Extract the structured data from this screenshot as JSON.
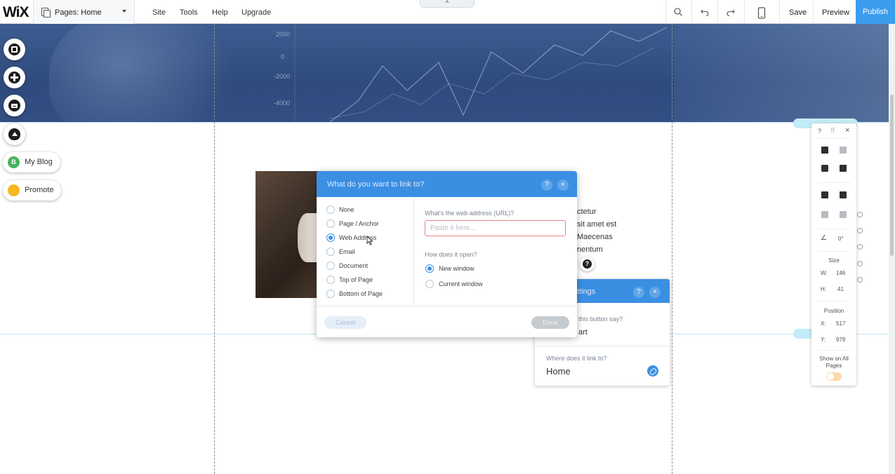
{
  "topbar": {
    "logo": "WiX",
    "pages_label": "Pages: Home",
    "menu": [
      "Site",
      "Tools",
      "Help",
      "Upgrade"
    ],
    "top_tab_glyph": "^",
    "icons": [
      "zoom-icon",
      "undo-icon",
      "redo-icon",
      "mobile-icon"
    ],
    "save": "Save",
    "preview": "Preview",
    "publish": "Publish"
  },
  "hero": {
    "axis_labels": [
      "2000",
      "0",
      "-2000",
      "-4000"
    ]
  },
  "left_tools": {
    "blog_badge": "B",
    "my_blog": "My Blog",
    "promote": "Promote"
  },
  "content": {
    "text_lines": [
      "ctetur",
      "sit amet est",
      "Maecenas",
      "nentum"
    ]
  },
  "link_dialog": {
    "title": "What do you want to link to?",
    "help": "?",
    "close": "×",
    "options": [
      "None",
      "Page / Anchor",
      "Web Address",
      "Email",
      "Document",
      "Top of Page",
      "Bottom of Page"
    ],
    "selected_option": "Web Address",
    "url_label": "What's the web address (URL)?",
    "url_placeholder": "Paste it here...",
    "url_value": "",
    "open_label": "How does it open?",
    "open_options": [
      "New window",
      "Current window"
    ],
    "open_selected": "New window",
    "cancel": "Cancel",
    "done": "Done"
  },
  "button_settings": {
    "title": "ttings",
    "help": "?",
    "close": "×",
    "question": "this button say?",
    "value": "art",
    "link_question": "Where does it link to?",
    "link_value": "Home"
  },
  "side_panel": {
    "help": "?",
    "drag": "⠿",
    "close": "×",
    "rotation": "0°",
    "size_label": "Size",
    "w_label": "W:",
    "w_value": "146",
    "h_label": "H:",
    "h_value": "41",
    "position_label": "Position",
    "x_label": "X:",
    "x_value": "517",
    "y_label": "Y:",
    "y_value": "979",
    "show_all_pages": "Show on All Pages"
  },
  "colors": {
    "accent": "#3b8fe3",
    "publish": "#3b9ded",
    "hero": "#3d5c8f",
    "error_border": "#e8828c"
  }
}
